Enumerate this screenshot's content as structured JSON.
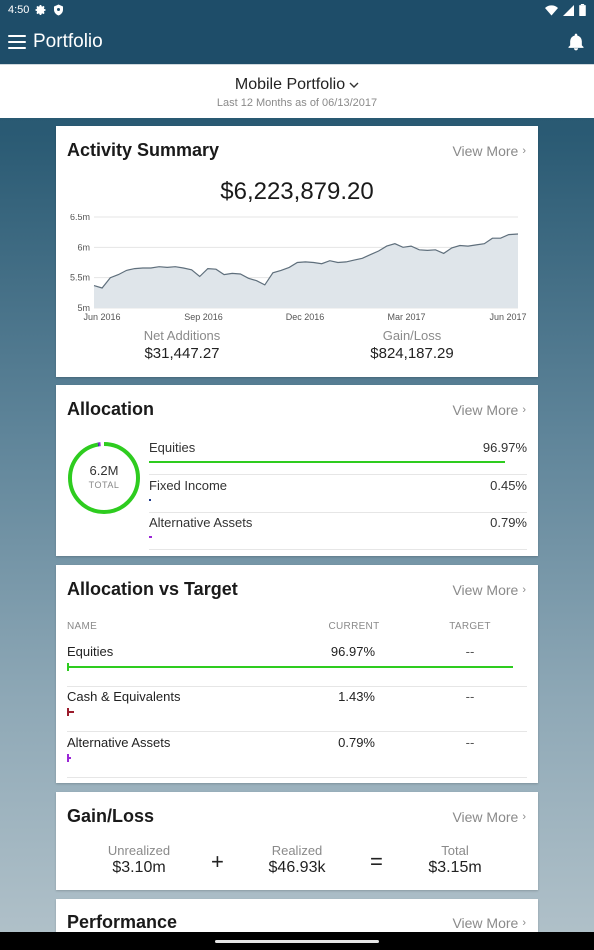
{
  "status_bar": {
    "time": "4:50"
  },
  "app_bar": {
    "title": "Portfolio"
  },
  "portfolio": {
    "name": "Mobile Portfolio",
    "subtitle": "Last 12 Months as of 06/13/2017"
  },
  "view_more_label": "View More",
  "activity": {
    "title": "Activity Summary",
    "total": "$6,223,879.20",
    "net_additions_label": "Net Additions",
    "net_additions": "$31,447.27",
    "gain_loss_label": "Gain/Loss",
    "gain_loss": "$824,187.29"
  },
  "chart_data": {
    "type": "area",
    "title": "",
    "xlabel": "",
    "ylabel": "",
    "ylim": [
      5.0,
      6.5
    ],
    "y_ticks": [
      "6.5m",
      "6m",
      "5.5m",
      "5m"
    ],
    "x_ticks": [
      "Jun 2016",
      "Sep 2016",
      "Dec 2016",
      "Mar 2017",
      "Jun 2017"
    ],
    "x_range": [
      "2016-06-13",
      "2017-06-13"
    ],
    "series": [
      {
        "points": [
          [
            "2016-06-13",
            5.37
          ],
          [
            "2016-06-20",
            5.33
          ],
          [
            "2016-06-27",
            5.5
          ],
          [
            "2016-07-04",
            5.55
          ],
          [
            "2016-07-11",
            5.62
          ],
          [
            "2016-07-18",
            5.65
          ],
          [
            "2016-07-25",
            5.66
          ],
          [
            "2016-08-01",
            5.66
          ],
          [
            "2016-08-08",
            5.68
          ],
          [
            "2016-08-15",
            5.67
          ],
          [
            "2016-08-22",
            5.68
          ],
          [
            "2016-08-29",
            5.66
          ],
          [
            "2016-09-05",
            5.63
          ],
          [
            "2016-09-12",
            5.52
          ],
          [
            "2016-09-19",
            5.65
          ],
          [
            "2016-09-26",
            5.64
          ],
          [
            "2016-10-03",
            5.55
          ],
          [
            "2016-10-10",
            5.57
          ],
          [
            "2016-10-17",
            5.56
          ],
          [
            "2016-10-24",
            5.49
          ],
          [
            "2016-10-31",
            5.45
          ],
          [
            "2016-11-07",
            5.38
          ],
          [
            "2016-11-14",
            5.58
          ],
          [
            "2016-11-21",
            5.62
          ],
          [
            "2016-11-28",
            5.67
          ],
          [
            "2016-12-05",
            5.75
          ],
          [
            "2016-12-12",
            5.76
          ],
          [
            "2016-12-19",
            5.75
          ],
          [
            "2016-12-26",
            5.73
          ],
          [
            "2017-01-02",
            5.78
          ],
          [
            "2017-01-09",
            5.75
          ],
          [
            "2017-01-16",
            5.76
          ],
          [
            "2017-01-23",
            5.79
          ],
          [
            "2017-01-30",
            5.82
          ],
          [
            "2017-02-06",
            5.88
          ],
          [
            "2017-02-13",
            5.94
          ],
          [
            "2017-02-20",
            6.02
          ],
          [
            "2017-02-27",
            6.06
          ],
          [
            "2017-03-06",
            6.0
          ],
          [
            "2017-03-13",
            6.02
          ],
          [
            "2017-03-20",
            5.96
          ],
          [
            "2017-03-27",
            5.95
          ],
          [
            "2017-04-03",
            5.96
          ],
          [
            "2017-04-10",
            5.9
          ],
          [
            "2017-04-17",
            5.99
          ],
          [
            "2017-04-24",
            6.03
          ],
          [
            "2017-05-01",
            6.02
          ],
          [
            "2017-05-08",
            6.04
          ],
          [
            "2017-05-15",
            6.06
          ],
          [
            "2017-05-22",
            6.15
          ],
          [
            "2017-05-29",
            6.15
          ],
          [
            "2017-06-05",
            6.21
          ],
          [
            "2017-06-13",
            6.22
          ]
        ]
      }
    ],
    "colors": {
      "line": "#5f6f7c",
      "fill": "#dfe5ea"
    }
  },
  "allocation": {
    "title": "Allocation",
    "donut_value": "6.2M",
    "donut_label": "TOTAL",
    "rows": [
      {
        "name": "Equities",
        "pct": "96.97%",
        "color": "#2ecc1f",
        "fraction": 0.9697
      },
      {
        "name": "Fixed Income",
        "pct": "0.45%",
        "color": "#1f3a8a",
        "fraction": 0.0045
      },
      {
        "name": "Alternative Assets",
        "pct": "0.79%",
        "color": "#9b27d6",
        "fraction": 0.0079
      }
    ]
  },
  "allocation_vs_target": {
    "title": "Allocation vs Target",
    "headers": {
      "name": "NAME",
      "current": "CURRENT",
      "target": "TARGET"
    },
    "rows": [
      {
        "name": "Equities",
        "current": "96.97%",
        "target": "--",
        "color": "#2ecc1f",
        "fraction": 0.9697
      },
      {
        "name": "Cash & Equivalents",
        "current": "1.43%",
        "target": "--",
        "color": "#9b1c2c",
        "fraction": 0.0143
      },
      {
        "name": "Alternative Assets",
        "current": "0.79%",
        "target": "--",
        "color": "#9b27d6",
        "fraction": 0.0079
      }
    ]
  },
  "gain_loss": {
    "title": "Gain/Loss",
    "unrealized_label": "Unrealized",
    "unrealized": "$3.10m",
    "realized_label": "Realized",
    "realized": "$46.93k",
    "total_label": "Total",
    "total": "$3.15m",
    "plus": "+",
    "equals": "="
  },
  "performance": {
    "title": "Performance"
  }
}
